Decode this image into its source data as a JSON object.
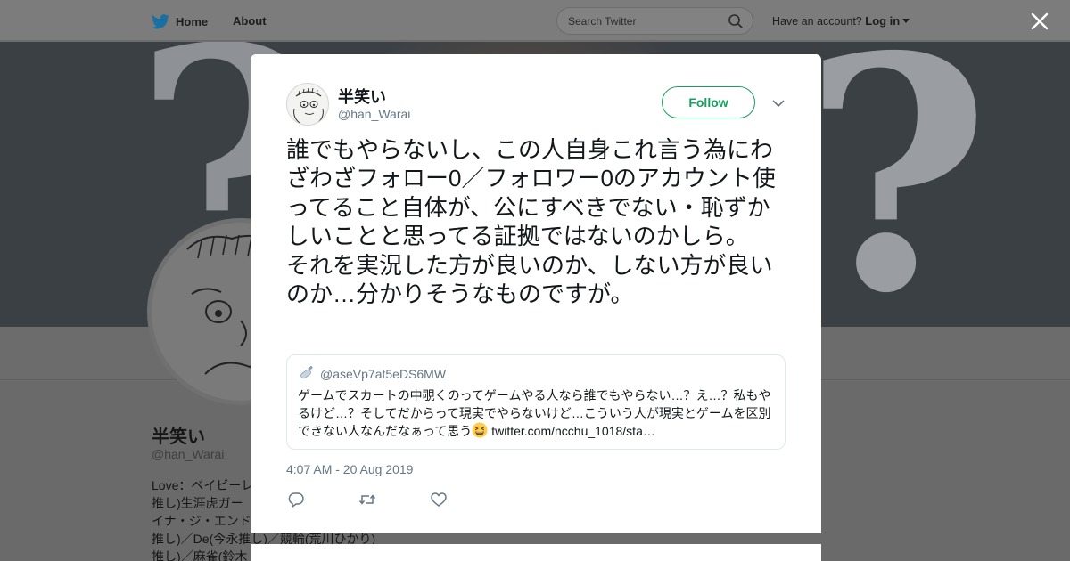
{
  "topbar": {
    "home_label": "Home",
    "about_label": "About",
    "search_placeholder": "Search Twitter",
    "account_prompt": "Have an account?",
    "login_label": "Log in"
  },
  "colors": {
    "accent_green": "#17a05d",
    "secondary_text": "#657786",
    "twitter_blue": "#1da1f2"
  },
  "profile": {
    "name": "半笑い",
    "handle": "@han_Warai",
    "bio_lines": [
      "Love：ベイビーレ",
      "推し)生涯虎ガー",
      "イナ・ジ・エンド",
      "推し)／De(今永推し)／競輪(荒川ひかり)",
      "推し)／麻雀(鈴木"
    ]
  },
  "tweet": {
    "author_name": "半笑い",
    "author_handle": "@han_Warai",
    "follow_label": "Follow",
    "text": "誰でもやらないし、この人自身これ言う為にわざわざフォロー0／フォロワー0のアカウント使ってること自体が、公にすべきでない・恥ずかしいことと思ってる証拠ではないのかしら。\nそれを実況した方が良いのか、しない方が良いのか…分かりそうなものですが。",
    "timestamp": "4:07 AM - 20 Aug 2019",
    "quoted": {
      "handle": "@aseVp7at5eDS6MW",
      "text_before": "ゲームでスカートの中覗くのってゲームやる人なら誰でもやらない…？え…？私もやるけど…？そしてだからって現実でやらないけど…こういう人が現実とゲームを区別できない人なんだなぁって思う",
      "link": "twitter.com/ncchu_1018/sta…"
    },
    "icons": [
      "reply-icon",
      "retweet-icon",
      "like-icon"
    ]
  }
}
